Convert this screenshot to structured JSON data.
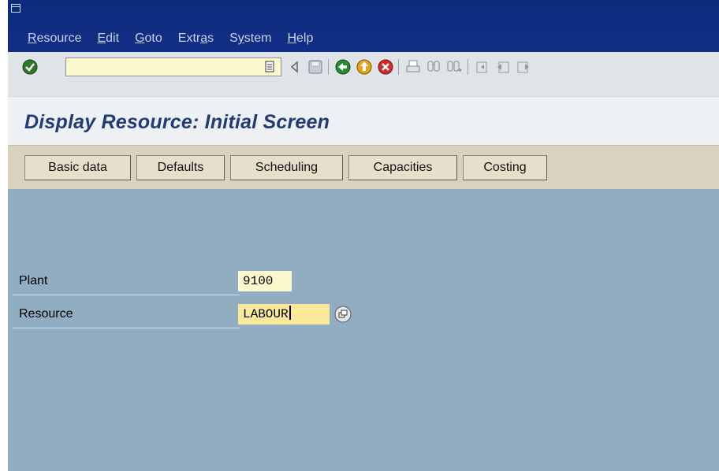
{
  "menu": {
    "items": [
      {
        "pre": "",
        "ul": "R",
        "post": "esource"
      },
      {
        "pre": "",
        "ul": "E",
        "post": "dit"
      },
      {
        "pre": "",
        "ul": "G",
        "post": "oto"
      },
      {
        "pre": "Extr",
        "ul": "a",
        "post": "s"
      },
      {
        "pre": "S",
        "ul": "y",
        "post": "stem"
      },
      {
        "pre": "",
        "ul": "H",
        "post": "elp"
      }
    ]
  },
  "toolbar": {
    "command_value": "",
    "icons": [
      "enter-icon",
      "history-icon",
      "back-triangle-icon",
      "save-icon",
      "back-icon",
      "exit-icon",
      "cancel-icon",
      "print-icon",
      "find-icon",
      "find-next-icon",
      "first-page-icon",
      "previous-page-icon",
      "next-page-icon"
    ]
  },
  "title": "Display Resource: Initial Screen",
  "app_toolbar": {
    "buttons": [
      "Basic data",
      "Defaults",
      "Scheduling",
      "Capacities",
      "Costing"
    ]
  },
  "fields": {
    "plant": {
      "label": "Plant",
      "value": "9100"
    },
    "resource": {
      "label": "Resource",
      "value": "LABOUR"
    }
  },
  "colors": {
    "menu_bg": "#0c2b7c",
    "title": "#223a78",
    "work_bg": "#91adc2",
    "input_bg": "#fbf8cd",
    "focused_input_bg": "#fce99a"
  }
}
